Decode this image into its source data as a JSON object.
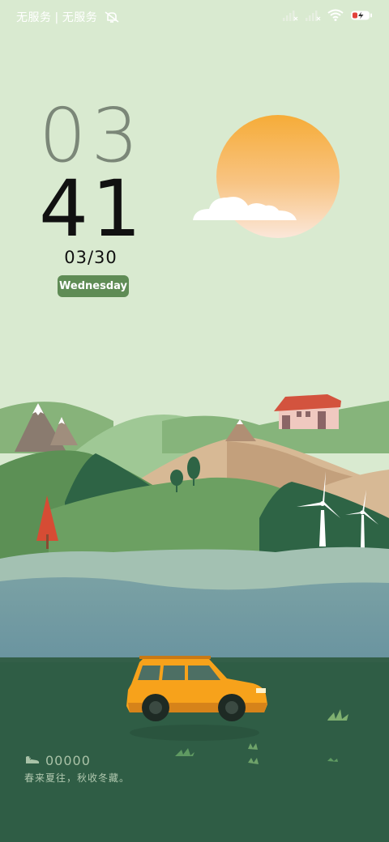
{
  "status_bar": {
    "carrier1": "无服务",
    "separator": "|",
    "carrier2": "无服务",
    "icons": [
      "mute-vibrate-icon",
      "signal-off-icon",
      "signal-off-icon",
      "wifi-icon",
      "battery-charging-icon"
    ]
  },
  "clock": {
    "hour": "03",
    "minute": "41",
    "date": "03/30",
    "weekday": "Wednesday"
  },
  "widget": {
    "step_count": "00000",
    "quote": "春来夏往，秋收冬藏。"
  },
  "colors": {
    "sky": "#d9ead0",
    "sun_top": "#f6ac38",
    "sun_bottom": "#fbe7da",
    "badge": "#5f8c55",
    "car": "#f7a21b",
    "water": "#6f9ba3",
    "ground": "#2f5d45"
  }
}
